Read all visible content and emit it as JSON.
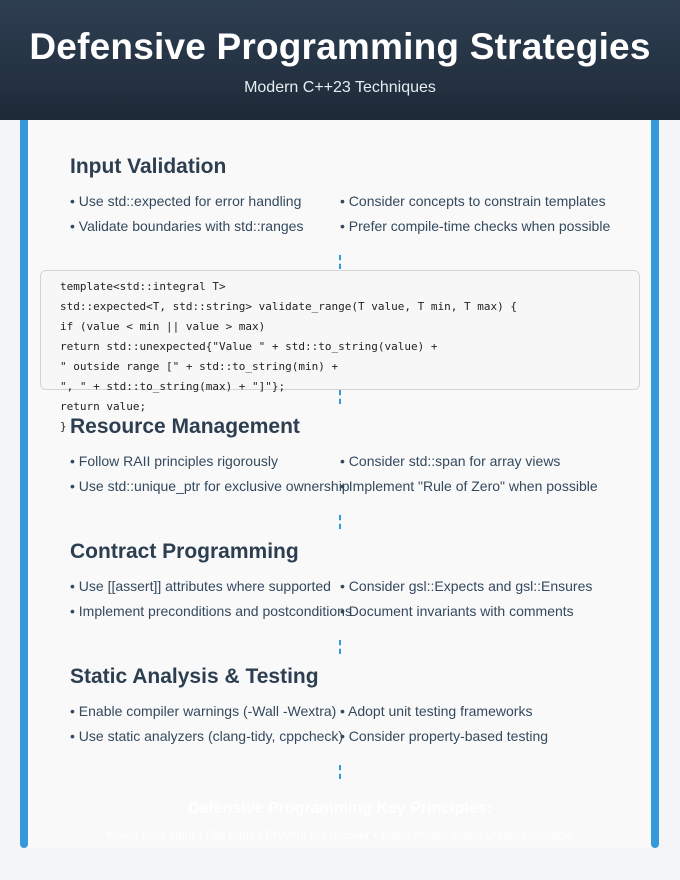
{
  "header": {
    "title": "Defensive Programming Strategies",
    "subtitle": "Modern C++23 Techniques"
  },
  "sections": [
    {
      "title": "Input Validation",
      "left": [
        "• Use std::expected for error handling",
        "• Validate boundaries with std::ranges"
      ],
      "right": [
        "• Consider concepts to constrain templates",
        "• Prefer compile-time checks when possible"
      ]
    },
    {
      "title": "Resource Management",
      "left": [
        "• Follow RAII principles rigorously",
        "• Use std::unique_ptr for exclusive ownership"
      ],
      "right": [
        "• Consider std::span for array views",
        "• Implement \"Rule of Zero\" when possible"
      ]
    },
    {
      "title": "Contract Programming",
      "left": [
        "• Use [[assert]] attributes where supported",
        "• Implement preconditions and postconditions"
      ],
      "right": [
        "• Consider gsl::Expects and gsl::Ensures",
        "• Document invariants with comments"
      ]
    },
    {
      "title": "Static Analysis & Testing",
      "left": [
        "• Enable compiler warnings (-Wall -Wextra)",
        "• Use static analyzers (clang-tidy, cppcheck)"
      ],
      "right": [
        "• Adopt unit testing frameworks",
        "• Consider property-based testing"
      ]
    }
  ],
  "code": [
    "template<std::integral T>",
    "std::expected<T, std::string> validate_range(T value, T min, T max) {",
    "if (value < min || value > max)",
    "return std::unexpected{\"Value \" + std::to_string(value) +",
    "\" outside range [\" + std::to_string(min) +",
    "\", \" + std::to_string(max) + \"]\"};",
    "return value;",
    "}"
  ],
  "footer": {
    "title": "Defensive Programming Key Principles:",
    "text": "Never trust input • Fail early • Prevent not recover • Make invalid states unrepresentable"
  }
}
